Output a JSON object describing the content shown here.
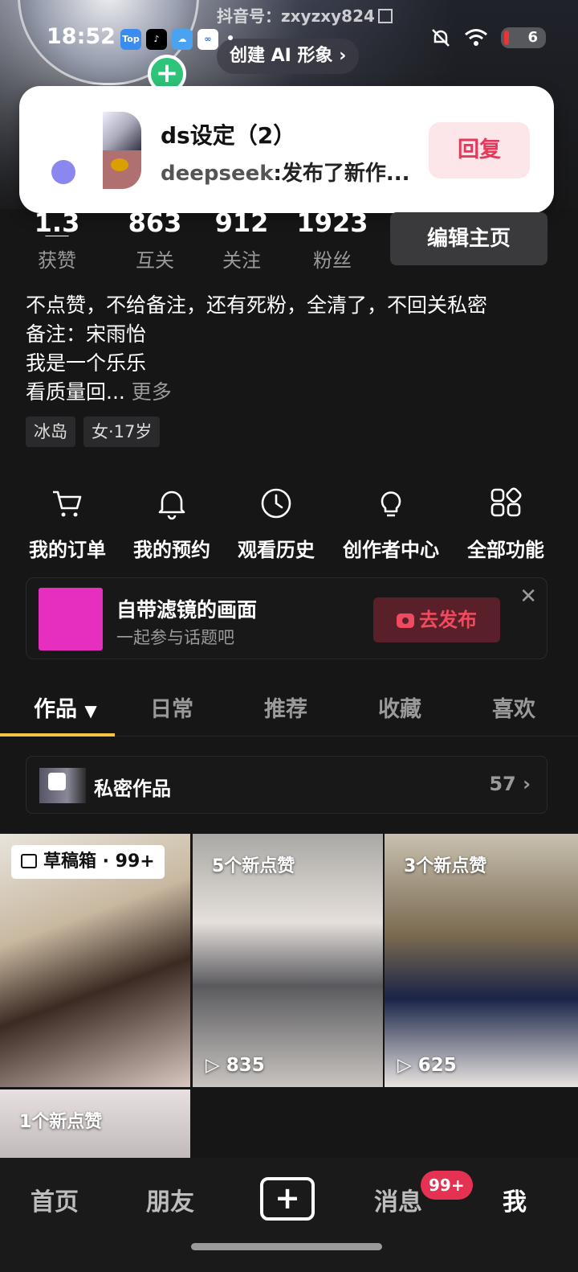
{
  "status_bar": {
    "time": "18:52",
    "battery": "6",
    "apps": [
      "Top",
      "♪",
      "☁",
      "∞"
    ]
  },
  "profile_header": {
    "douyin_id": "抖音号：zxyzxy824",
    "ai_chip": "创建 AI 形象 ›"
  },
  "notification": {
    "title": "ds设定（2）",
    "sender": "deepseek",
    "message": ":发布了新作...",
    "reply_label": "回复"
  },
  "stats": [
    {
      "num": "1.3万",
      "label": "获赞"
    },
    {
      "num": "863",
      "label": "互关"
    },
    {
      "num": "912",
      "label": "关注"
    },
    {
      "num": "1923",
      "label": "粉丝"
    }
  ],
  "edit_profile_label": "编辑主页",
  "bio": {
    "line1": "不点赞，不给备注，还有死粉，全清了，不回关私密",
    "line2": "备注：宋雨怡",
    "line3": "我是一个乐乐",
    "line4": "看质量回...",
    "more": "更多"
  },
  "tags": [
    "冰岛",
    "女·17岁"
  ],
  "features": [
    {
      "label": "我的订单",
      "icon": "cart-icon"
    },
    {
      "label": "我的预约",
      "icon": "bell-icon"
    },
    {
      "label": "观看历史",
      "icon": "clock-icon"
    },
    {
      "label": "创作者中心",
      "icon": "bulb-icon"
    },
    {
      "label": "全部功能",
      "icon": "grid-icon"
    }
  ],
  "topic_card": {
    "title": "自带滤镜的画面",
    "subtitle": "一起参与话题吧",
    "cta": "去发布"
  },
  "tabs": [
    "作品",
    "日常",
    "推荐",
    "收藏",
    "喜欢"
  ],
  "private_works": {
    "label": "私密作品",
    "count": "57 ›"
  },
  "grid": [
    {
      "badge": "草稿箱 · 99+"
    },
    {
      "likes": "5个新点赞",
      "plays": "835"
    },
    {
      "likes": "3个新点赞",
      "plays": "625"
    },
    {
      "likes": "1个新点赞"
    }
  ],
  "nav": {
    "home": "首页",
    "friends": "朋友",
    "messages": "消息",
    "messages_badge": "99+",
    "me": "我"
  },
  "colors": {
    "accent_red": "#e63252",
    "tab_underline": "#f6c343",
    "topic_thumb": "#e62ebf"
  }
}
